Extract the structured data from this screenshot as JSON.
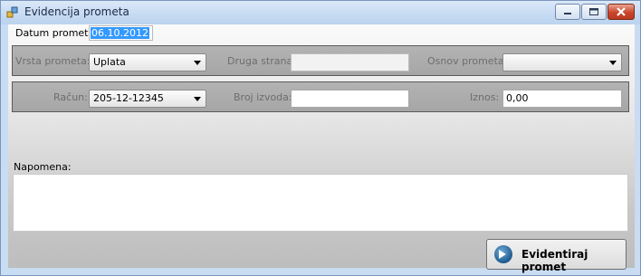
{
  "window": {
    "title": "Evidencija prometa"
  },
  "form": {
    "datum_label": "Datum prometa:",
    "datum_value": "06.10.2012",
    "vrsta_label": "Vrsta prometa:",
    "vrsta_value": "Uplata",
    "druga_label": "Druga strana:",
    "druga_value": "",
    "osnov_label": "Osnov prometa:",
    "osnov_value": "",
    "racun_label": "Račun:",
    "racun_value": "205-12-12345",
    "broj_label": "Broj izvoda:",
    "broj_value": "",
    "iznos_label": "Iznos:",
    "iznos_value": "0,00",
    "napomena_label": "Napomena:",
    "napomena_value": "",
    "submit_label": "Evidentiraj promet"
  },
  "icons": {
    "app": "app-icon",
    "submit": "arrow-right-circle-icon"
  }
}
